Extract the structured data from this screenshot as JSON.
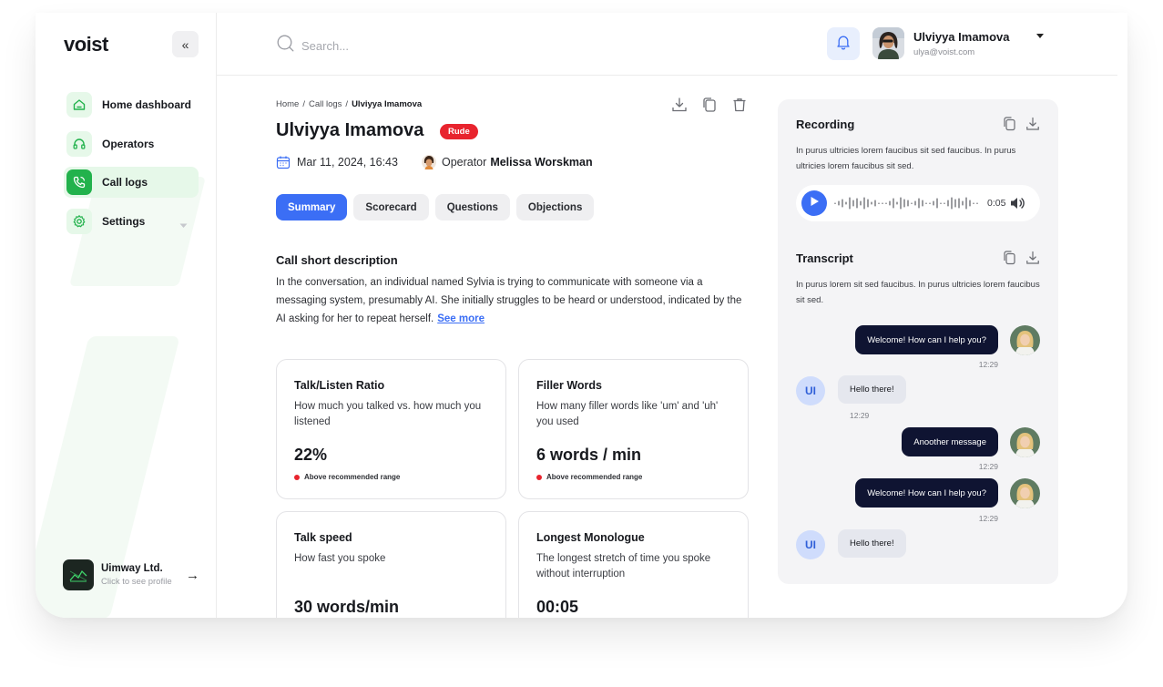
{
  "app": {
    "logo": "voist"
  },
  "sidebar": {
    "items": [
      {
        "label": "Home dashboard",
        "icon": "home-icon",
        "active": false
      },
      {
        "label": "Operators",
        "icon": "headset-icon",
        "active": false
      },
      {
        "label": "Call logs",
        "icon": "phone-icon",
        "active": true
      },
      {
        "label": "Settings",
        "icon": "gear-icon",
        "active": false
      }
    ],
    "company": {
      "name": "Uimway Ltd.",
      "subtitle": "Click to see profile"
    }
  },
  "header": {
    "search_placeholder": "Search...",
    "user": {
      "name": "Ulviyya Imamova",
      "email": "ulya@voist.com"
    }
  },
  "main": {
    "breadcrumb": [
      "Home",
      "Call logs",
      "Ulviyya Imamova"
    ],
    "title": "Ulviyya Imamova",
    "badge": "Rude",
    "datetime": "Mar 11, 2024, 16:43",
    "operator_label": "Operator",
    "operator_name": "Melissa Worskman",
    "tabs": [
      "Summary",
      "Scorecard",
      "Questions",
      "Objections"
    ],
    "active_tab": "Summary",
    "description": {
      "title": "Call short description",
      "text": "In the conversation, an individual named Sylvia is trying to communicate with someone via a messaging system, presumably AI. She initially struggles to be heard or understood, indicated by the AI asking for her to repeat herself.",
      "link": "See more"
    },
    "metrics": [
      {
        "title": "Talk/Listen Ratio",
        "desc": "How much you talked vs. how much you listened",
        "value": "22%",
        "status": "Above recommended range"
      },
      {
        "title": "Filler Words",
        "desc": "How many filler words like 'um' and 'uh' you used",
        "value": "6 words / min",
        "status": "Above recommended range"
      },
      {
        "title": "Talk speed",
        "desc": "How fast you spoke",
        "value": "30 words/min",
        "status": ""
      },
      {
        "title": "Longest Monologue",
        "desc": "The longest stretch of time you spoke without interruption",
        "value": "00:05",
        "status": ""
      }
    ]
  },
  "panel": {
    "recording": {
      "title": "Recording",
      "desc": "In purus ultricies lorem faucibus sit sed faucibus. In purus ultricies lorem faucibus sit sed.",
      "time": "0:05"
    },
    "transcript": {
      "title": "Transcript",
      "desc": "In purus lorem sit sed faucibus. In purus ultricies lorem faucibus sit sed.",
      "messages": [
        {
          "from": "agent",
          "text": "Welcome! How can I help you?",
          "time": "12:29"
        },
        {
          "from": "user",
          "avatar": "UI",
          "text": "Hello there!",
          "time": "12:29"
        },
        {
          "from": "agent",
          "text": "Anoother message",
          "time": "12:29"
        },
        {
          "from": "agent",
          "text": "Welcome! How can I help you?",
          "time": "12:29"
        },
        {
          "from": "user",
          "avatar": "UI",
          "text": "Hello there!",
          "time": ""
        }
      ]
    }
  },
  "colors": {
    "accent": "#3b6ef5",
    "green": "#22b24c",
    "danger": "#e8242e",
    "dark_bubble": "#0f1432"
  }
}
